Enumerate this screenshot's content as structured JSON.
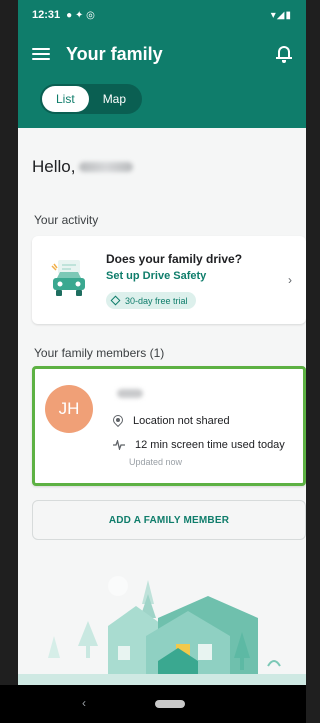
{
  "status": {
    "time": "12:31"
  },
  "appbar": {
    "title": "Your family"
  },
  "view_toggle": {
    "list_label": "List",
    "map_label": "Map",
    "selected": "List"
  },
  "greeting": "Hello,",
  "activity": {
    "section_label": "Your activity",
    "card_title": "Does your family drive?",
    "card_link": "Set up Drive Safety",
    "trial_badge": "30-day free trial"
  },
  "members": {
    "section_label": "Your family members (1)",
    "items": [
      {
        "initials": "JH",
        "location_status": "Location not shared",
        "screen_time": "12 min screen time used today",
        "updated": "Updated now"
      }
    ]
  },
  "add_member_label": "ADD A FAMILY MEMBER",
  "colors": {
    "brand": "#0f7d6b",
    "highlight": "#5db143",
    "avatar": "#f0a077"
  },
  "icons": [
    "menu-icon",
    "notification-bell-icon",
    "car-icon",
    "gem-icon",
    "chevron-right-icon",
    "location-pin-icon",
    "activity-pulse-icon",
    "back-icon",
    "home-icon"
  ]
}
